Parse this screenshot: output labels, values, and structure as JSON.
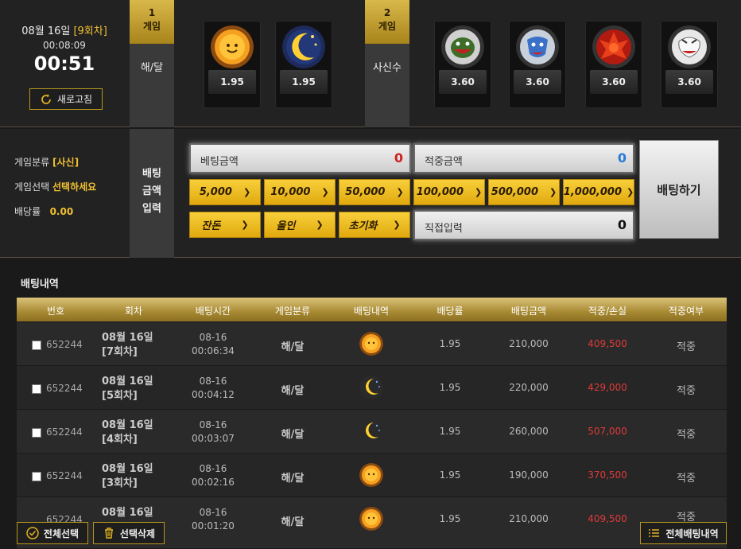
{
  "clock": {
    "date": "08월 16일",
    "round": "[9회차]",
    "time": "00:08:09",
    "remaining": "00:51",
    "refresh_label": "새로고침"
  },
  "game1": {
    "num": "1",
    "title": "게임",
    "label": "해/달"
  },
  "game2": {
    "num": "2",
    "title": "게임",
    "label": "사신수"
  },
  "cards": [
    {
      "icon": "sun-icon",
      "odds": "1.95"
    },
    {
      "icon": "moon-icon",
      "odds": "1.95"
    },
    {
      "icon": "turtle-icon",
      "odds": "3.60"
    },
    {
      "icon": "blue-dragon-icon",
      "odds": "3.60"
    },
    {
      "icon": "red-phoenix-icon",
      "odds": "3.60"
    },
    {
      "icon": "white-tiger-icon",
      "odds": "3.60"
    }
  ],
  "info": {
    "category_label": "게임분류",
    "category_value": "[사신]",
    "select_label": "게임선택",
    "select_value": "선택하세요",
    "odds_label": "배당률",
    "odds_value": "0.00"
  },
  "bet_input_label": [
    "배팅",
    "금액",
    "입력"
  ],
  "fields": {
    "bet_amount_label": "베팅금액",
    "bet_amount_value": "0",
    "win_amount_label": "적중금액",
    "win_amount_value": "0",
    "direct_label": "직접입력",
    "direct_value": "0"
  },
  "chips": [
    "5,000",
    "10,000",
    "50,000",
    "100,000",
    "500,000",
    "1,000,000"
  ],
  "chips2": [
    "잔돈",
    "올인",
    "초기화"
  ],
  "bet_button": "배팅하기",
  "history": {
    "title": "배팅내역",
    "columns": [
      "번호",
      "회차",
      "배팅시간",
      "게임분류",
      "배팅내역",
      "배당률",
      "배팅금액",
      "적중/손실",
      "적중여부"
    ],
    "rows": [
      {
        "no": "652244",
        "date": "08월 16일",
        "round": "[7회차]",
        "d": "08-16",
        "t": "00:06:34",
        "cat": "해/달",
        "pick": "sun",
        "odds": "1.95",
        "amount": "210,000",
        "result": "409,500",
        "status": "적중"
      },
      {
        "no": "652244",
        "date": "08월 16일",
        "round": "[5회차]",
        "d": "08-16",
        "t": "00:04:12",
        "cat": "해/달",
        "pick": "moon",
        "odds": "1.95",
        "amount": "220,000",
        "result": "429,000",
        "status": "적중"
      },
      {
        "no": "652244",
        "date": "08월 16일",
        "round": "[4회차]",
        "d": "08-16",
        "t": "00:03:07",
        "cat": "해/달",
        "pick": "moon",
        "odds": "1.95",
        "amount": "260,000",
        "result": "507,000",
        "status": "적중"
      },
      {
        "no": "652244",
        "date": "08월 16일",
        "round": "[3회차]",
        "d": "08-16",
        "t": "00:02:16",
        "cat": "해/달",
        "pick": "sun",
        "odds": "1.95",
        "amount": "190,000",
        "result": "370,500",
        "status": "적중"
      },
      {
        "no": "652244",
        "date": "08월 16일",
        "round": "",
        "d": "08-16",
        "t": "00:01:20",
        "cat": "해/달",
        "pick": "sun",
        "odds": "1.95",
        "amount": "210,000",
        "result": "409,500",
        "status": "적중"
      }
    ]
  },
  "footer": {
    "select_all": "전체선택",
    "delete_selected": "선택삭제",
    "all_history": "전체배팅내역"
  }
}
